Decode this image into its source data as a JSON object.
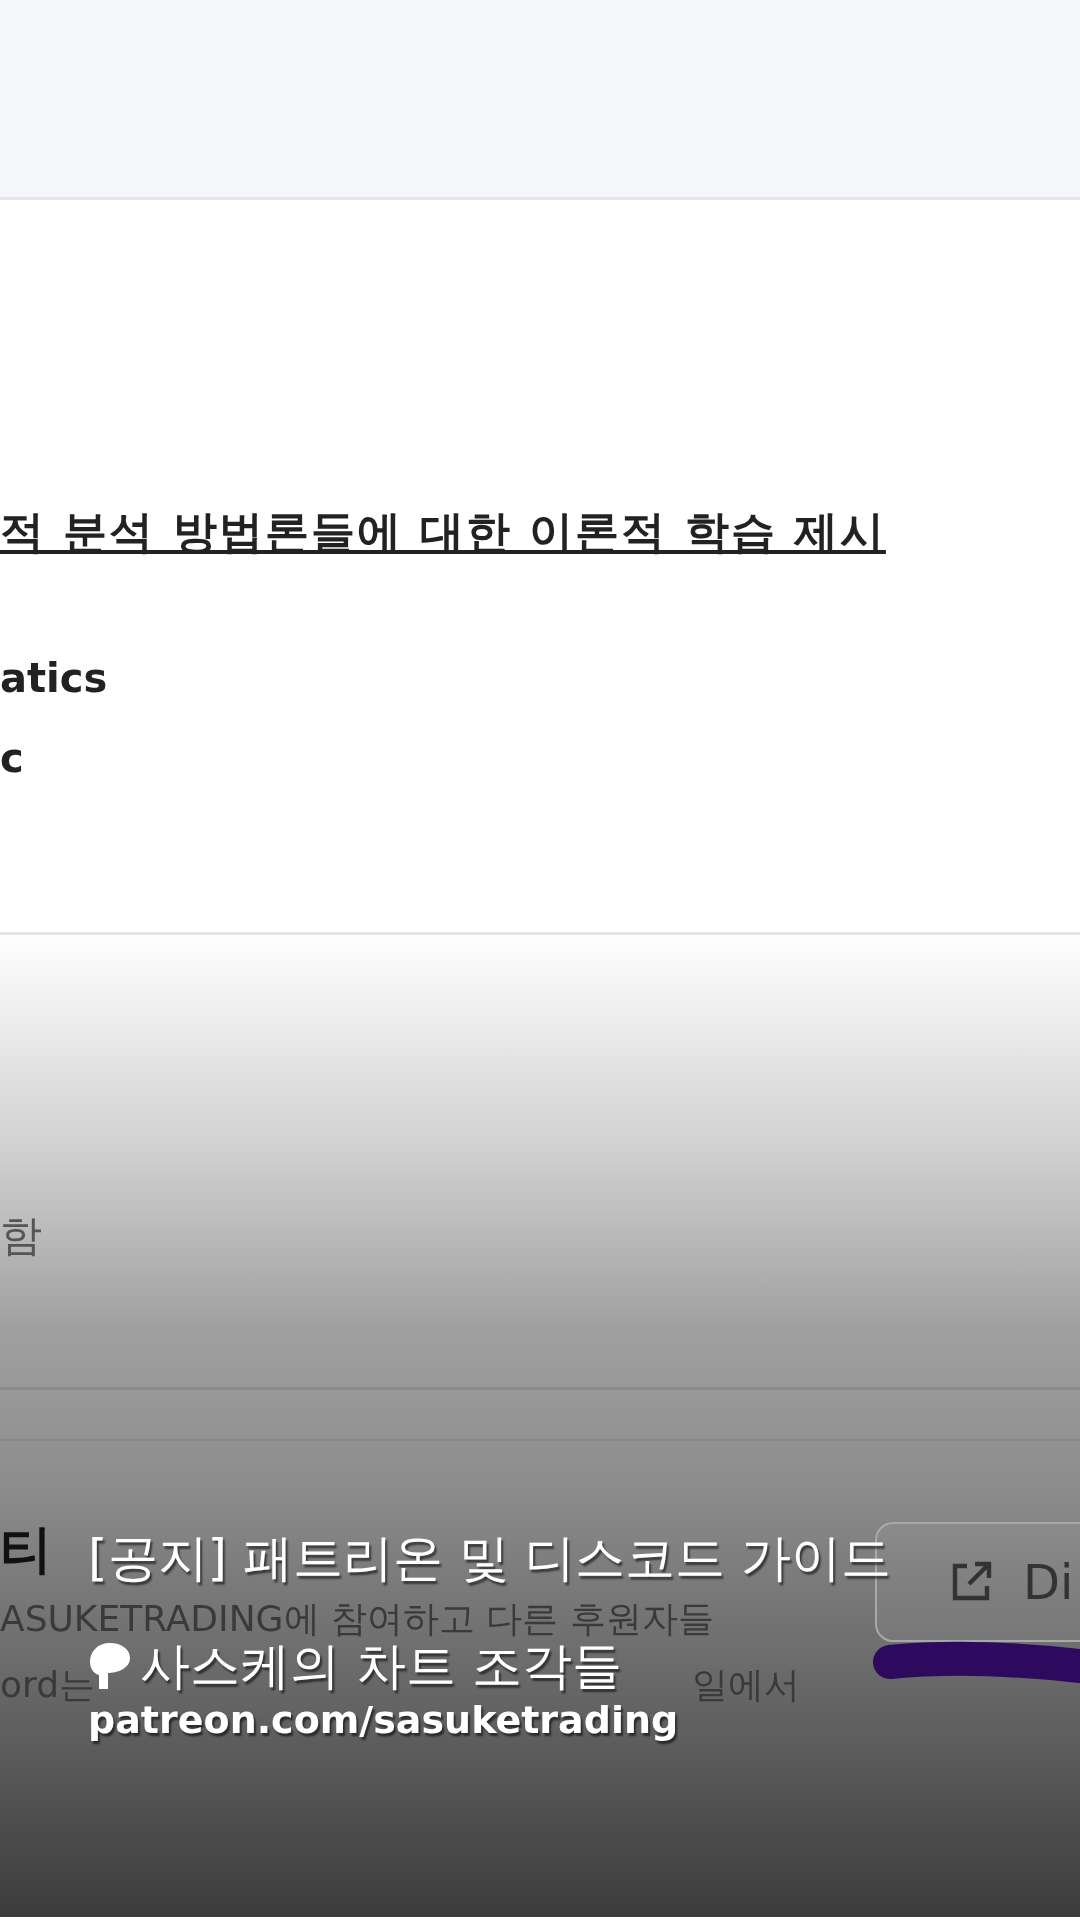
{
  "page": {
    "heading": "적 분석 방법론들에 대한 이론적 학습 제시",
    "lines": [
      "atics",
      "c"
    ],
    "note": "함",
    "section_title": "티",
    "description": "ASUKETRADING에 참여하고 다른 후원자들",
    "partial_line": [
      "ord는",
      "일에서"
    ],
    "button": {
      "label": "Di"
    }
  },
  "link_preview": {
    "title": "[공지] 패트리온 및 디스코드 가이드",
    "site_name": "사스케의 차트 조각들",
    "url": "patreon.com/sasuketrading"
  }
}
